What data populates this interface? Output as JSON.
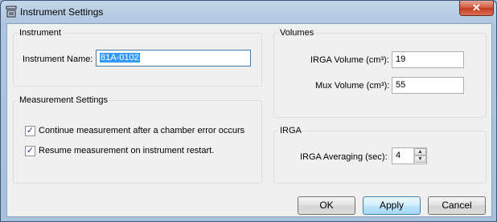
{
  "window": {
    "title": "Instrument Settings",
    "close_glyph": "✕",
    "icon": "instrument-icon"
  },
  "instrument_group": {
    "label": "Instrument",
    "name_label": "Instrument Name:",
    "name_value": "81A-0102"
  },
  "measurement_group": {
    "label": "Measurement Settings",
    "continue_label": "Continue measurement after a chamber error occurs",
    "continue_checked": true,
    "resume_label": "Resume measurement on instrument restart.",
    "resume_checked": true,
    "check_glyph": "✓"
  },
  "volumes_group": {
    "label": "Volumes",
    "irga_volume_label": "IRGA Volume  (cm³):",
    "irga_volume_value": "19",
    "mux_volume_label": "Mux Volume  (cm³):",
    "mux_volume_value": "55"
  },
  "irga_group": {
    "label": "IRGA",
    "averaging_label": "IRGA Averaging (sec):",
    "averaging_value": "4",
    "spin_up": "▲",
    "spin_down": "▼"
  },
  "buttons": {
    "ok": "OK",
    "apply": "Apply",
    "cancel": "Cancel"
  }
}
